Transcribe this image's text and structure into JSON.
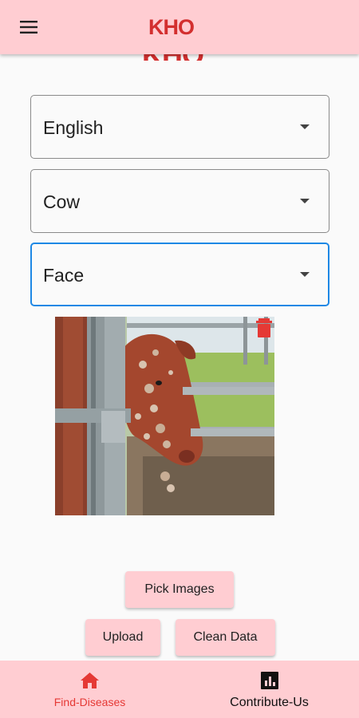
{
  "app_bar": {
    "logo_text": "KHO",
    "brand_color": "#d32f2f",
    "background": "#ffcdd2",
    "menu_icon": "hamburger-menu-icon"
  },
  "form": {
    "language_select": {
      "value": "English"
    },
    "animal_select": {
      "value": "Cow"
    },
    "body_part_select": {
      "value": "Face"
    }
  },
  "image_preview": {
    "description_icon": "delete-icon"
  },
  "actions": {
    "pick_images_label": "Pick Images",
    "upload_label": "Upload",
    "clean_data_label": "Clean Data"
  },
  "bottom_nav": {
    "items": [
      {
        "label": "Find-Diseases",
        "icon": "home-icon",
        "active": true
      },
      {
        "label": "Contribute-Us",
        "icon": "bar-chart-icon",
        "active": false
      }
    ]
  },
  "colors": {
    "accent_pink": "#ffcdd2",
    "active_red": "#e53935",
    "focus_blue": "#1e88e5"
  }
}
